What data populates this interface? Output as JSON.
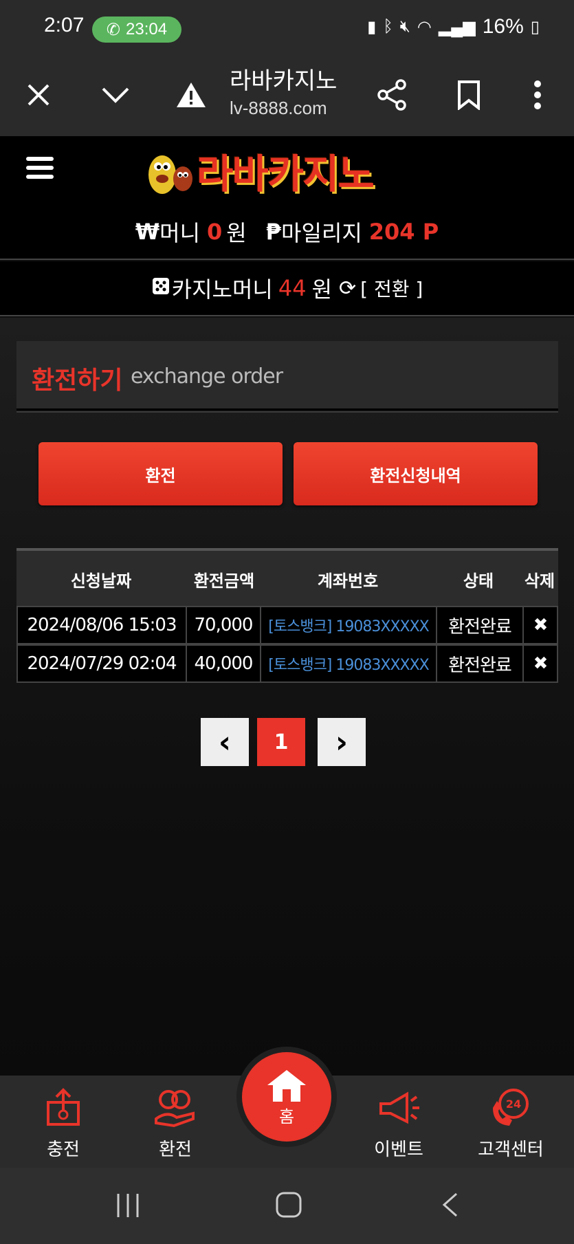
{
  "status_bar": {
    "time": "2:07",
    "call_timer": "23:04",
    "battery": "16%"
  },
  "browser": {
    "title": "라바카지노",
    "url": "lv-8888.com"
  },
  "site": {
    "logo_text": "라바카지노"
  },
  "money": {
    "money_label": "머니",
    "money_value": "0",
    "money_unit": "원",
    "mileage_label": "마일리지",
    "mileage_value": "204 P",
    "casino_label": "카지노머니",
    "casino_value": "44",
    "casino_unit": "원",
    "convert_label": "[ 전환 ]"
  },
  "section": {
    "title": "환전하기",
    "subtitle": "exchange order"
  },
  "buttons": {
    "exchange": "환전",
    "history": "환전신청내역"
  },
  "table": {
    "headers": [
      "신청날짜",
      "환전금액",
      "계좌번호",
      "상태",
      "삭제"
    ],
    "rows": [
      {
        "date": "2024/08/06 15:03",
        "amount": "70,000",
        "account": "[토스뱅크] 19083XXXXX",
        "status": "환전완료",
        "delete": "✖"
      },
      {
        "date": "2024/07/29 02:04",
        "amount": "40,000",
        "account": "[토스뱅크] 19083XXXXX",
        "status": "환전완료",
        "delete": "✖"
      }
    ]
  },
  "pagination": {
    "prev": "‹",
    "current": "1",
    "next": "›"
  },
  "bottom_nav": {
    "charge": "충전",
    "exchange": "환전",
    "home": "홈",
    "event": "이벤트",
    "support": "고객센터"
  },
  "colors": {
    "accent": "#e8342a",
    "account_link": "#4a8fd8"
  }
}
